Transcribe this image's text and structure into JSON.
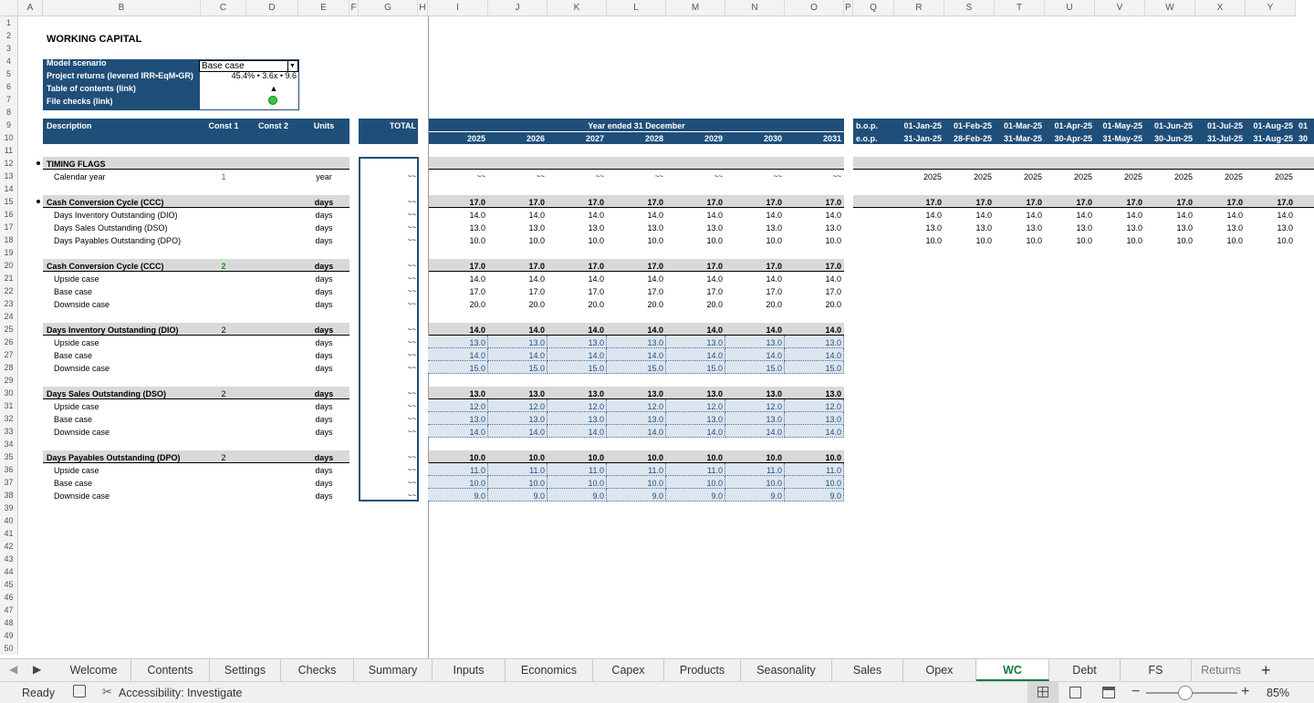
{
  "columns": [
    "A",
    "B",
    "C",
    "D",
    "E",
    "F",
    "G",
    "H",
    "I",
    "J",
    "K",
    "L",
    "M",
    "N",
    "O",
    "P",
    "Q",
    "R",
    "S",
    "T",
    "U",
    "V",
    "W",
    "X",
    "Y"
  ],
  "rows": [
    "1",
    "2",
    "3",
    "4",
    "5",
    "6",
    "7",
    "8",
    "9",
    "10",
    "11",
    "12",
    "13",
    "14",
    "15",
    "16",
    "17",
    "18",
    "19",
    "20",
    "21",
    "22",
    "23",
    "24",
    "25",
    "26",
    "27",
    "28",
    "29",
    "30",
    "31",
    "32",
    "33",
    "34",
    "35",
    "36",
    "37",
    "38",
    "39",
    "40",
    "41",
    "42",
    "43",
    "44",
    "45",
    "46",
    "47",
    "48",
    "49",
    "50"
  ],
  "title": "WORKING CAPITAL",
  "info_box": {
    "scenario_label": "Model scenario",
    "scenario_value": "Base case",
    "returns_label": "Project returns (levered IRR•EqM•GR)",
    "returns_value": "45.4% • 3.6x • 9.6",
    "toc_label": "Table of contents (link)",
    "toc_value": "▲",
    "checks_label": "File checks (link)"
  },
  "header": {
    "description": "Description",
    "const1": "Const 1",
    "const2": "Const 2",
    "units": "Units",
    "total": "TOTAL",
    "year_ended": "Year ended 31 December",
    "bop": "b.o.p.",
    "eop": "e.o.p."
  },
  "years": [
    "2025",
    "2026",
    "2027",
    "2028",
    "2029",
    "2030",
    "2031"
  ],
  "months_bop": [
    "01-Jan-25",
    "01-Feb-25",
    "01-Mar-25",
    "01-Apr-25",
    "01-May-25",
    "01-Jun-25",
    "01-Jul-25",
    "01-Aug-25",
    "01"
  ],
  "months_eop": [
    "31-Jan-25",
    "28-Feb-25",
    "31-Mar-25",
    "30-Apr-25",
    "31-May-25",
    "30-Jun-25",
    "31-Jul-25",
    "31-Aug-25",
    "30"
  ],
  "dash": "~~",
  "sections": [
    {
      "row": 12,
      "label": "TIMING FLAGS",
      "grey": true,
      "bullet": true,
      "monthly": true
    },
    {
      "row": 13,
      "label": "Calendar year",
      "indent": true,
      "const1": "1",
      "units": "year",
      "total": "~~",
      "annual": [
        "~~",
        "~~",
        "~~",
        "~~",
        "~~",
        "~~",
        "~~"
      ],
      "monthly_vals": [
        "2025",
        "2025",
        "2025",
        "2025",
        "2025",
        "2025",
        "2025",
        "2025"
      ]
    },
    {
      "row": 15,
      "label": "Cash Conversion Cycle (CCC)",
      "grey": true,
      "bold": true,
      "bullet": true,
      "units": "days",
      "total": "~~",
      "annual": [
        "17.0",
        "17.0",
        "17.0",
        "17.0",
        "17.0",
        "17.0",
        "17.0"
      ],
      "monthly_vals": [
        "17.0",
        "17.0",
        "17.0",
        "17.0",
        "17.0",
        "17.0",
        "17.0",
        "17.0"
      ],
      "monthly": true
    },
    {
      "row": 16,
      "label": "Days Inventory Outstanding (DIO)",
      "indent": true,
      "units": "days",
      "total": "~~",
      "annual": [
        "14.0",
        "14.0",
        "14.0",
        "14.0",
        "14.0",
        "14.0",
        "14.0"
      ],
      "monthly_vals": [
        "14.0",
        "14.0",
        "14.0",
        "14.0",
        "14.0",
        "14.0",
        "14.0",
        "14.0"
      ]
    },
    {
      "row": 17,
      "label": "Days Sales Outstanding (DSO)",
      "indent": true,
      "units": "days",
      "total": "~~",
      "annual": [
        "13.0",
        "13.0",
        "13.0",
        "13.0",
        "13.0",
        "13.0",
        "13.0"
      ],
      "monthly_vals": [
        "13.0",
        "13.0",
        "13.0",
        "13.0",
        "13.0",
        "13.0",
        "13.0",
        "13.0"
      ]
    },
    {
      "row": 18,
      "label": "Days Payables Outstanding (DPO)",
      "indent": true,
      "units": "days",
      "total": "~~",
      "annual": [
        "10.0",
        "10.0",
        "10.0",
        "10.0",
        "10.0",
        "10.0",
        "10.0"
      ],
      "monthly_vals": [
        "10.0",
        "10.0",
        "10.0",
        "10.0",
        "10.0",
        "10.0",
        "10.0",
        "10.0"
      ]
    },
    {
      "row": 20,
      "label": "Cash Conversion Cycle (CCC)",
      "grey": true,
      "bold": true,
      "const1": "2",
      "const1green": true,
      "units": "days",
      "total": "~~",
      "annual": [
        "17.0",
        "17.0",
        "17.0",
        "17.0",
        "17.0",
        "17.0",
        "17.0"
      ]
    },
    {
      "row": 21,
      "label": "Upside case",
      "indent": true,
      "units": "days",
      "total": "~~",
      "annual": [
        "14.0",
        "14.0",
        "14.0",
        "14.0",
        "14.0",
        "14.0",
        "14.0"
      ]
    },
    {
      "row": 22,
      "label": "Base case",
      "indent": true,
      "units": "days",
      "total": "~~",
      "annual": [
        "17.0",
        "17.0",
        "17.0",
        "17.0",
        "17.0",
        "17.0",
        "17.0"
      ]
    },
    {
      "row": 23,
      "label": "Downside case",
      "indent": true,
      "units": "days",
      "total": "~~",
      "annual": [
        "20.0",
        "20.0",
        "20.0",
        "20.0",
        "20.0",
        "20.0",
        "20.0"
      ]
    },
    {
      "row": 25,
      "label": "Days Inventory Outstanding (DIO)",
      "grey": true,
      "bold": true,
      "const1": "2",
      "units": "days",
      "total": "~~",
      "annual": [
        "14.0",
        "14.0",
        "14.0",
        "14.0",
        "14.0",
        "14.0",
        "14.0"
      ]
    },
    {
      "row": 26,
      "label": "Upside case",
      "indent": true,
      "units": "days",
      "total": "~~",
      "input": true,
      "annual": [
        "13.0",
        "13.0",
        "13.0",
        "13.0",
        "13.0",
        "13.0",
        "13.0"
      ]
    },
    {
      "row": 27,
      "label": "Base case",
      "indent": true,
      "units": "days",
      "total": "~~",
      "input": true,
      "annual": [
        "14.0",
        "14.0",
        "14.0",
        "14.0",
        "14.0",
        "14.0",
        "14.0"
      ]
    },
    {
      "row": 28,
      "label": "Downside case",
      "indent": true,
      "units": "days",
      "total": "~~",
      "input": true,
      "annual": [
        "15.0",
        "15.0",
        "15.0",
        "15.0",
        "15.0",
        "15.0",
        "15.0"
      ]
    },
    {
      "row": 30,
      "label": "Days Sales Outstanding (DSO)",
      "grey": true,
      "bold": true,
      "const1": "2",
      "units": "days",
      "total": "~~",
      "annual": [
        "13.0",
        "13.0",
        "13.0",
        "13.0",
        "13.0",
        "13.0",
        "13.0"
      ]
    },
    {
      "row": 31,
      "label": "Upside case",
      "indent": true,
      "units": "days",
      "total": "~~",
      "input": true,
      "annual": [
        "12.0",
        "12.0",
        "12.0",
        "12.0",
        "12.0",
        "12.0",
        "12.0"
      ]
    },
    {
      "row": 32,
      "label": "Base case",
      "indent": true,
      "units": "days",
      "total": "~~",
      "input": true,
      "annual": [
        "13.0",
        "13.0",
        "13.0",
        "13.0",
        "13.0",
        "13.0",
        "13.0"
      ]
    },
    {
      "row": 33,
      "label": "Downside case",
      "indent": true,
      "units": "days",
      "total": "~~",
      "input": true,
      "annual": [
        "14.0",
        "14.0",
        "14.0",
        "14.0",
        "14.0",
        "14.0",
        "14.0"
      ]
    },
    {
      "row": 35,
      "label": "Days Payables Outstanding (DPO)",
      "grey": true,
      "bold": true,
      "const1": "2",
      "units": "days",
      "total": "~~",
      "annual": [
        "10.0",
        "10.0",
        "10.0",
        "10.0",
        "10.0",
        "10.0",
        "10.0"
      ]
    },
    {
      "row": 36,
      "label": "Upside case",
      "indent": true,
      "units": "days",
      "total": "~~",
      "input": true,
      "annual": [
        "11.0",
        "11.0",
        "11.0",
        "11.0",
        "11.0",
        "11.0",
        "11.0"
      ]
    },
    {
      "row": 37,
      "label": "Base case",
      "indent": true,
      "units": "days",
      "total": "~~",
      "input": true,
      "annual": [
        "10.0",
        "10.0",
        "10.0",
        "10.0",
        "10.0",
        "10.0",
        "10.0"
      ]
    },
    {
      "row": 38,
      "label": "Downside case",
      "indent": true,
      "units": "days",
      "total": "~~",
      "input": true,
      "annual": [
        "9.0",
        "9.0",
        "9.0",
        "9.0",
        "9.0",
        "9.0",
        "9.0"
      ]
    }
  ],
  "tabs": [
    "Welcome",
    "Contents",
    "Settings",
    "Checks",
    "Summary",
    "Inputs",
    "Economics",
    "Capex",
    "Products",
    "Seasonality",
    "Sales",
    "Opex",
    "WC",
    "Debt",
    "FS",
    "Returns"
  ],
  "active_tab": "WC",
  "status": {
    "ready": "Ready",
    "accessibility": "Accessibility: Investigate",
    "zoom": "85%"
  },
  "colors": {
    "header_blue": "#1f4e79",
    "input_fill": "#dde5ef",
    "active_tab": "#107c41",
    "check_ok": "#2ecc40"
  }
}
